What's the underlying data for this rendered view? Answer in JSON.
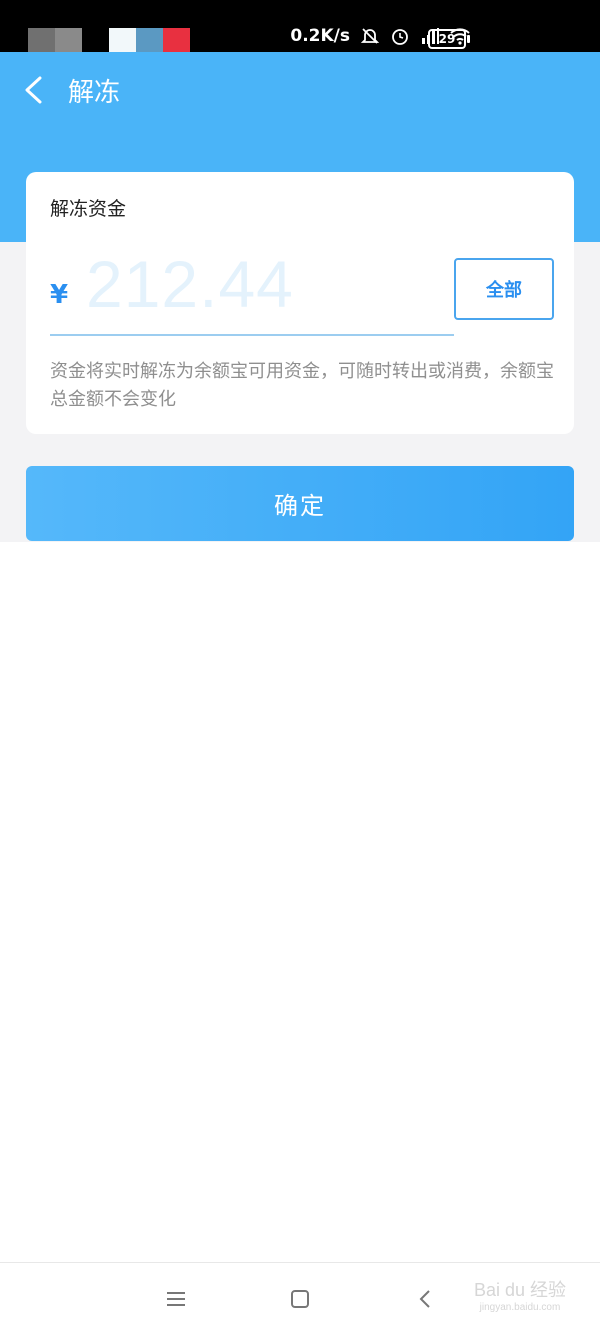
{
  "status_bar": {
    "network_speed": "0.2K/s",
    "battery": "29",
    "icons": [
      "bell-off-icon",
      "alarm-icon",
      "signal-icon",
      "wifi-icon",
      "battery-icon"
    ],
    "blocks": [
      "#707070",
      "#8a8a8a",
      "#000000",
      "#f2f8fa",
      "#5b99c2",
      "#e83040"
    ]
  },
  "header": {
    "back_icon": "chevron-left-icon",
    "title": "解冻",
    "color": "#4ab4f8"
  },
  "card": {
    "label": "解冻资金",
    "currency": "¥",
    "amount": "212.44",
    "all_button": "全部",
    "description": "资金将实时解冻为余额宝可用资金，可随时转出或消费，余额宝总金额不会变化"
  },
  "confirm": {
    "label": "确定"
  },
  "nav": {
    "icons": [
      "menu-icon",
      "home-square-icon",
      "back-icon"
    ]
  },
  "watermark": {
    "text": "Bai du 经验",
    "sub": "jingyan.baidu.com"
  }
}
